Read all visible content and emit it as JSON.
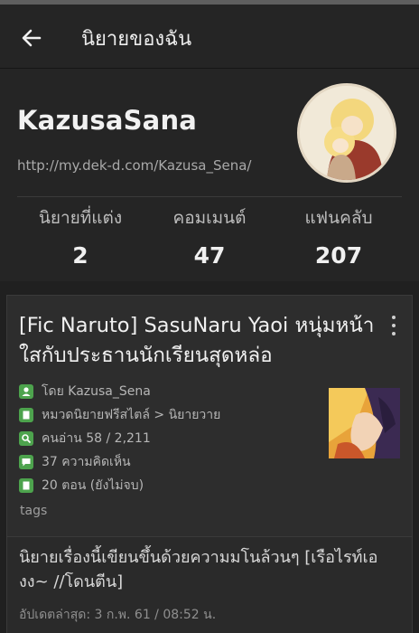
{
  "appbar": {
    "title": "นิยายของฉัน",
    "back_icon": "arrow-left-icon"
  },
  "profile": {
    "username": "KazusaSana",
    "url": "http://my.dek-d.com/Kazusa_Sena/",
    "avatar_icon": "avatar-image",
    "stats": [
      {
        "label": "นิยายที่แต่ง",
        "value": "2"
      },
      {
        "label": "คอมเมนต์",
        "value": "47"
      },
      {
        "label": "แฟนคลับ",
        "value": "207"
      }
    ]
  },
  "novel": {
    "title": "[Fic Naruto] SasuNaru Yaoi หนุ่มหน้าใสกับประธานนักเรียนสุดหล่อ",
    "author": "โดย Kazusa_Sena",
    "category": "หมวดนิยายฟรีสไตล์ > นิยายวาย",
    "readers": "คนอ่าน 58 / 2,211",
    "comments": "37 ความคิดเห็น",
    "chapters": "20 ตอน (ยังไม่จบ)",
    "tags_label": "tags",
    "description": "นิยายเรื่องนี้เขียนขึ้นด้วยความมโนล้วนๆ [เรือไรท์เองง~ //โดนตีน]",
    "updated": "อัปเดตล่าสุด: 3 ก.พ. 61 / 08:52 น.",
    "accent_color": "#4da34d"
  }
}
